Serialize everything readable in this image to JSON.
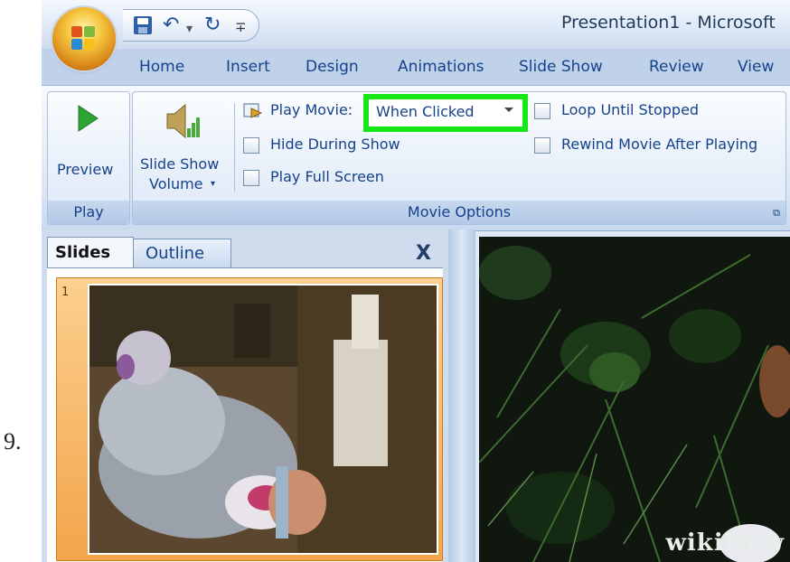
{
  "step_number": "9.",
  "window": {
    "title": "Presentation1 - Microsoft"
  },
  "quick_access": {
    "save_icon": "save-icon",
    "undo_glyph": "↶",
    "redo_glyph": "↻",
    "dropdown_glyph": "▾",
    "customize_glyph": "∓"
  },
  "tabs": [
    {
      "label": "Home"
    },
    {
      "label": "Insert"
    },
    {
      "label": "Design"
    },
    {
      "label": "Animations"
    },
    {
      "label": "Slide Show"
    },
    {
      "label": "Review"
    },
    {
      "label": "View"
    }
  ],
  "ribbon": {
    "play_group": {
      "preview_label": "Preview",
      "group_label": "Play"
    },
    "movie_options_group": {
      "group_label": "Movie Options",
      "volume_label_line1": "Slide Show",
      "volume_label_line2": "Volume",
      "play_movie_label": "Play Movie:",
      "play_movie_value": "When Clicked",
      "hide_during_show": "Hide During Show",
      "play_full_screen": "Play Full Screen",
      "loop_until_stopped": "Loop Until Stopped",
      "rewind_after_playing": "Rewind Movie After Playing"
    }
  },
  "pane": {
    "tab_slides": "Slides",
    "tab_outline": "Outline",
    "close_glyph": "X",
    "slide_number": "1"
  },
  "colors": {
    "highlight": "#17e617",
    "ribbon_text": "#15428b",
    "selected_slide": "#f3a54b"
  },
  "watermark": "wikiHow"
}
